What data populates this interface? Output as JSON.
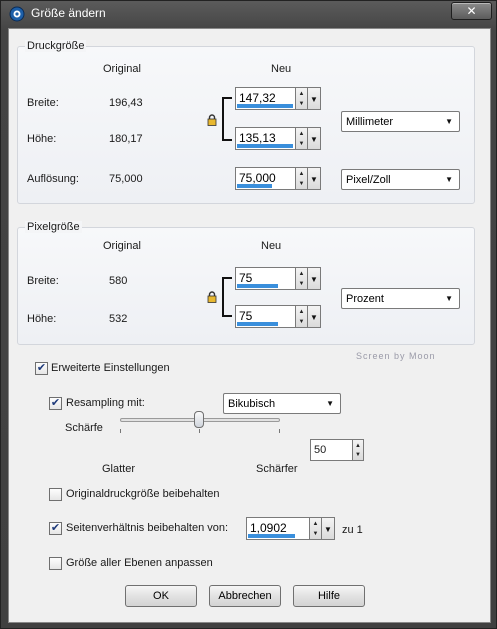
{
  "window": {
    "title": "Größe ändern",
    "close_symbol": "✕"
  },
  "print_size": {
    "group_title": "Druckgröße",
    "col_original": "Original",
    "col_new": "Neu",
    "width_label": "Breite:",
    "width_original": "196,43",
    "width_new": "147,32",
    "height_label": "Höhe:",
    "height_original": "180,17",
    "height_new": "135,13",
    "unit": "Millimeter",
    "resolution_label": "Auflösung:",
    "resolution_original": "75,000",
    "resolution_new": "75,000",
    "resolution_unit": "Pixel/Zoll",
    "width_new_fill": 0.95,
    "height_new_fill": 0.95,
    "resolution_new_fill": 0.6
  },
  "pixel_size": {
    "group_title": "Pixelgröße",
    "col_original": "Original",
    "col_new": "Neu",
    "width_label": "Breite:",
    "width_original": "580",
    "width_new": "75",
    "height_label": "Höhe:",
    "height_original": "532",
    "height_new": "75",
    "unit": "Prozent",
    "width_new_fill": 0.7,
    "height_new_fill": 0.7
  },
  "watermark": "Screen by Moon",
  "advanced": {
    "label": "Erweiterte Einstellungen",
    "checked": true,
    "resampling_label": "Resampling mit:",
    "resampling_checked": true,
    "resampling_method": "Bikubisch",
    "sharpness_label": "Schärfe",
    "sharpness_value": "50",
    "slider_left_label": "Glatter",
    "slider_right_label": "Schärfer",
    "keep_print_size_label": "Originaldruckgröße beibehalten",
    "keep_print_size_checked": false,
    "keep_aspect_label": "Seitenverhältnis beibehalten von:",
    "keep_aspect_checked": true,
    "aspect_value": "1,0902",
    "aspect_fill": 0.75,
    "aspect_suffix": "zu 1",
    "resize_layers_label": "Größe aller Ebenen anpassen",
    "resize_layers_checked": false
  },
  "buttons": {
    "ok": "OK",
    "cancel": "Abbrechen",
    "help": "Hilfe"
  },
  "colors": {
    "accent": "#3a8fdc",
    "frame": "#444444"
  },
  "icons": {
    "app": "resize-app-icon",
    "lock": "lock-icon",
    "dropdown": "chevron-down-icon"
  }
}
